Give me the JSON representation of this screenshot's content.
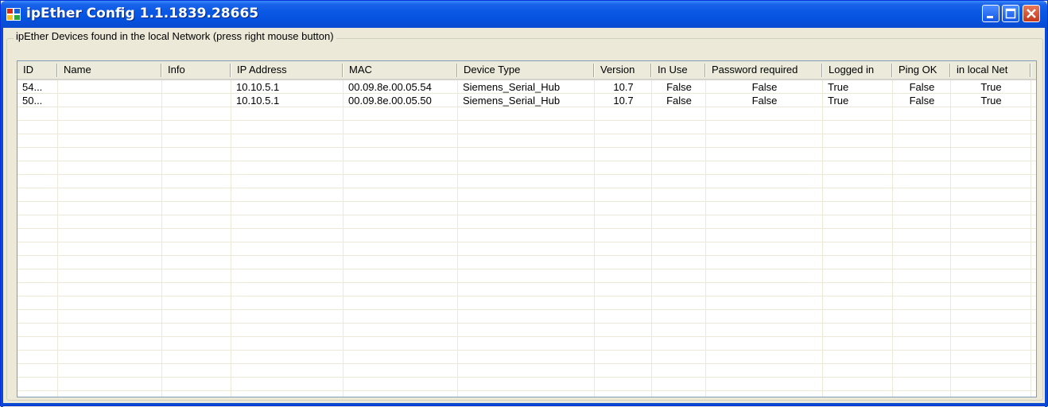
{
  "window": {
    "title": "ipEther Config 1.1.1839.28665",
    "icons": {
      "app": "app-icon",
      "minimize": "minimize-icon",
      "maximize": "maximize-icon",
      "close": "close-icon"
    },
    "title_color": "#0a58e4"
  },
  "group": {
    "label": "ipEther Devices found in the local Network (press right mouse button)"
  },
  "table": {
    "columns": [
      "ID",
      "Name",
      "Info",
      "IP Address",
      "MAC",
      "Device Type",
      "Version",
      "In Use",
      "Password required",
      "Logged in",
      "Ping OK",
      "in local Net"
    ],
    "rows": [
      [
        "54...",
        "",
        "",
        "10.10.5.1",
        "00.09.8e.00.05.54",
        "Siemens_Serial_Hub",
        "10.7",
        "False",
        "False",
        "True",
        "False",
        "True"
      ],
      [
        "50...",
        "",
        "",
        "10.10.5.1",
        "00.09.8e.00.05.50",
        "Siemens_Serial_Hub",
        "10.7",
        "False",
        "False",
        "True",
        "False",
        "True"
      ]
    ]
  }
}
